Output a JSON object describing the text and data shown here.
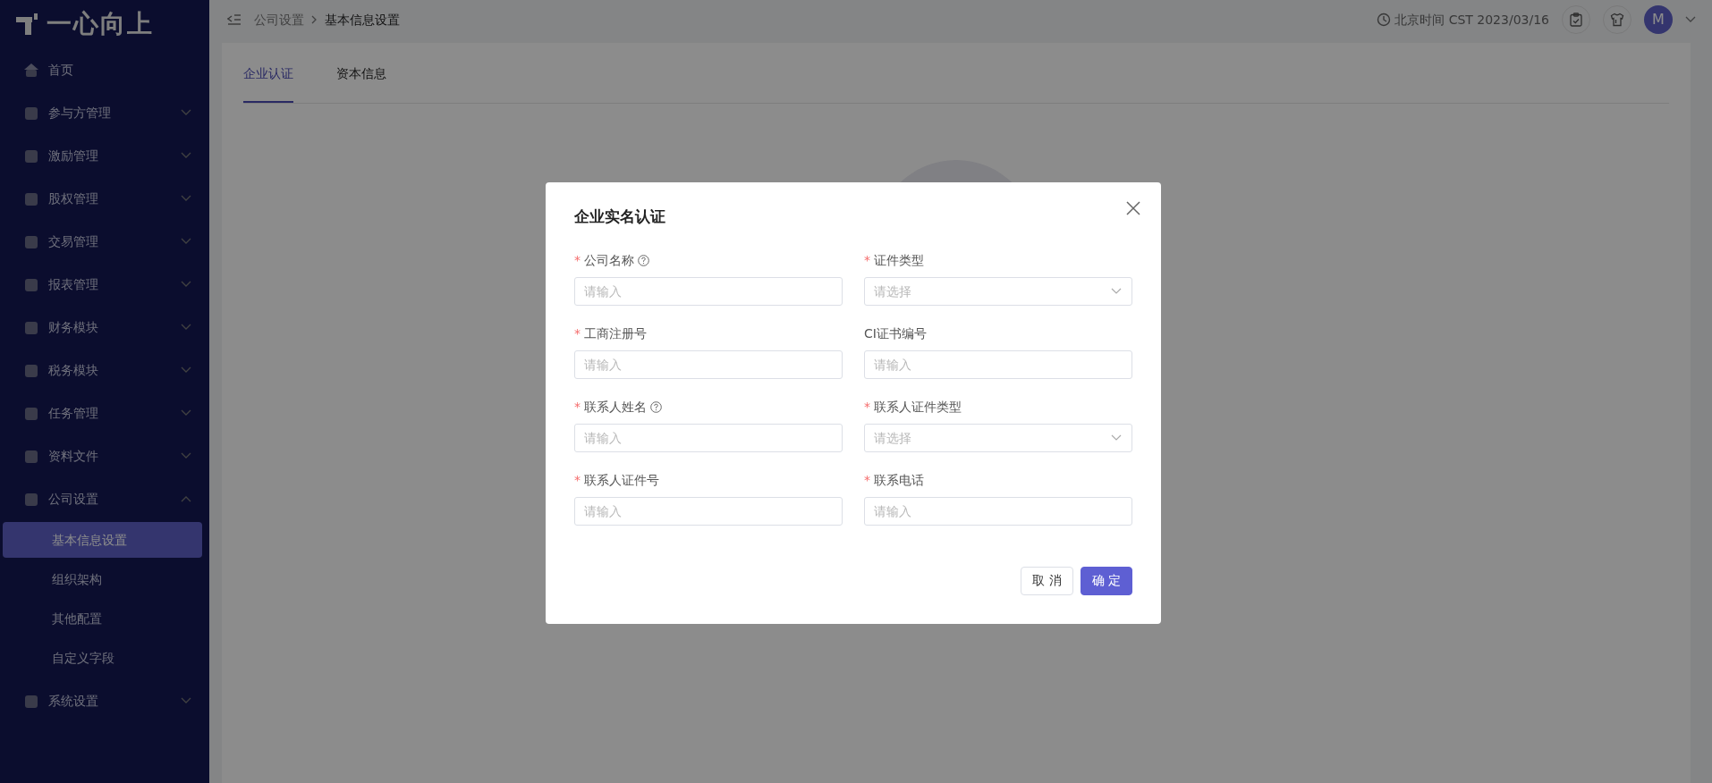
{
  "logo": {
    "text": "一心向上"
  },
  "sidebar": {
    "items": [
      {
        "label": "首页",
        "selected": false
      },
      {
        "label": "参与方管理",
        "selected": false,
        "expanded": false
      },
      {
        "label": "激励管理",
        "selected": false,
        "expanded": false
      },
      {
        "label": "股权管理",
        "selected": false,
        "expanded": false
      },
      {
        "label": "交易管理",
        "selected": false,
        "expanded": false
      },
      {
        "label": "报表管理",
        "selected": false,
        "expanded": false
      },
      {
        "label": "财务模块",
        "selected": false,
        "expanded": false
      },
      {
        "label": "税务模块",
        "selected": false,
        "expanded": false
      },
      {
        "label": "任务管理",
        "selected": false,
        "expanded": false
      },
      {
        "label": "资料文件",
        "selected": false,
        "expanded": false
      },
      {
        "label": "公司设置",
        "selected": false,
        "expanded": true,
        "children": [
          {
            "label": "基本信息设置",
            "selected": true
          },
          {
            "label": "组织架构",
            "selected": false
          },
          {
            "label": "其他配置",
            "selected": false
          },
          {
            "label": "自定义字段",
            "selected": false
          }
        ]
      },
      {
        "label": "系统设置",
        "selected": false,
        "expanded": false
      }
    ]
  },
  "header": {
    "breadcrumb": [
      "公司设置",
      "基本信息设置"
    ],
    "time": "北京时间 CST 2023/03/16",
    "avatar": "M"
  },
  "tabs": [
    {
      "label": "企业认证",
      "selected": true
    },
    {
      "label": "资本信息",
      "selected": false
    }
  ],
  "dialog": {
    "title": "企业实名认证",
    "fields": [
      {
        "required_mark": "*",
        "label": "公司名称",
        "help": true,
        "kind": "input",
        "placeholder": "请输入"
      },
      {
        "required_mark": "*",
        "label": "证件类型",
        "help": false,
        "kind": "select",
        "placeholder": "请选择"
      },
      {
        "required_mark": "*",
        "label": "工商注册号",
        "help": false,
        "kind": "input",
        "placeholder": "请输入"
      },
      {
        "label": "CI证书编号",
        "help": false,
        "kind": "input",
        "placeholder": "请输入"
      },
      {
        "required_mark": "*",
        "label": "联系人姓名",
        "help": true,
        "kind": "input",
        "placeholder": "请输入"
      },
      {
        "required_mark": "*",
        "label": "联系人证件类型",
        "help": false,
        "kind": "select",
        "placeholder": "请选择"
      },
      {
        "required_mark": "*",
        "label": "联系人证件号",
        "help": false,
        "kind": "input",
        "placeholder": "请输入"
      },
      {
        "required_mark": "*",
        "label": "联系电话",
        "help": false,
        "kind": "input",
        "placeholder": "请输入"
      }
    ],
    "buttons": [
      {
        "label": "取 消",
        "kind": "secondary"
      },
      {
        "label": "确 定",
        "kind": "primary"
      }
    ]
  }
}
